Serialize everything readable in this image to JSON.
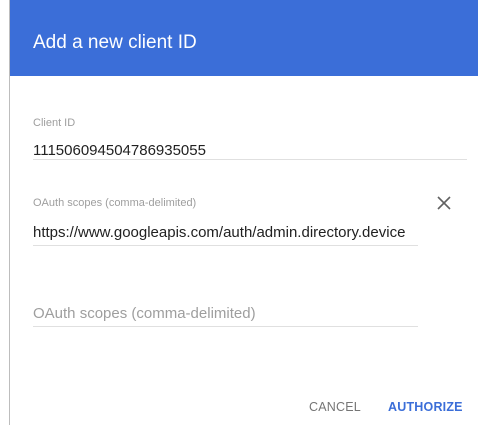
{
  "dialog": {
    "title": "Add a new client ID"
  },
  "client_id": {
    "label": "Client ID",
    "value": "111506094504786935055"
  },
  "scope_1": {
    "label": "OAuth scopes (comma-delimited)",
    "value": "https://www.googleapis.com/auth/admin.directory.device"
  },
  "scope_2": {
    "placeholder": "OAuth scopes (comma-delimited)",
    "value": ""
  },
  "actions": {
    "cancel_label": "CANCEL",
    "authorize_label": "AUTHORIZE"
  },
  "icons": {
    "remove_scope": "close-icon"
  },
  "colors": {
    "header": "#3b6ed8",
    "accent": "#3b6ed8",
    "cancel_text": "#757575"
  }
}
